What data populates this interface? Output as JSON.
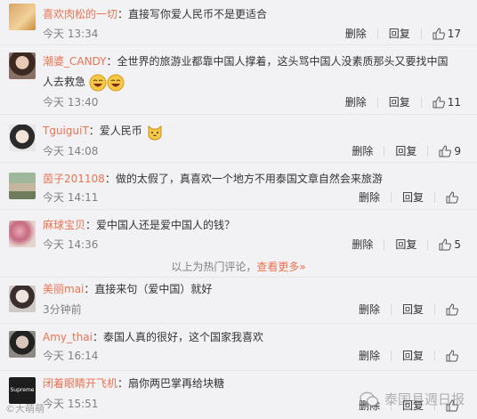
{
  "actions": {
    "delete": "删除",
    "reply": "回复"
  },
  "comments": [
    {
      "name": "喜欢肉松的一切",
      "text": "直接写你爱人民币不是更适合",
      "time": "今天 13:34",
      "likes": "17"
    },
    {
      "name": "潮婆_CANDY",
      "text": "全世界的旅游业都靠中国人撑着，这头骂中国人没素质那头又要找中国",
      "text2": "人去救急",
      "time": "今天 13:40",
      "likes": "11"
    },
    {
      "name": "TguiguiT",
      "text": "爱人民币",
      "time": "今天 14:08",
      "likes": "9"
    },
    {
      "name": "茵子201108",
      "text": "做的太假了，真喜欢一个地方不用泰国文章自然会来旅游",
      "time": "今天 14:11",
      "likes": ""
    },
    {
      "name": "麻球宝贝",
      "text": "爱中国人还是爱中国人的钱？",
      "time": "今天 14:36",
      "likes": "5"
    }
  ],
  "hot": {
    "text": "以上为热门评论，",
    "link": "查看更多»"
  },
  "comments2": [
    {
      "name": "美丽mai",
      "text": "直接来句（爱中国）就好",
      "time": "3分钟前",
      "likes": ""
    },
    {
      "name": "Amy_thai",
      "text": "泰国人真的很好，这个国家我喜欢",
      "time": "今天 16:14",
      "likes": ""
    },
    {
      "name": "闭着眼睛开飞机",
      "text": "扇你两巴掌再给块糖",
      "time": "今天 15:51",
      "likes": ""
    }
  ],
  "avatar_labels": {
    "c3": "Supreme"
  },
  "watermark": "泰国县週日报",
  "watermark_left": "©大萌萌",
  "colors": {
    "name": "#eb7350",
    "meta": "#808080",
    "bg": "#f2f2f5"
  }
}
